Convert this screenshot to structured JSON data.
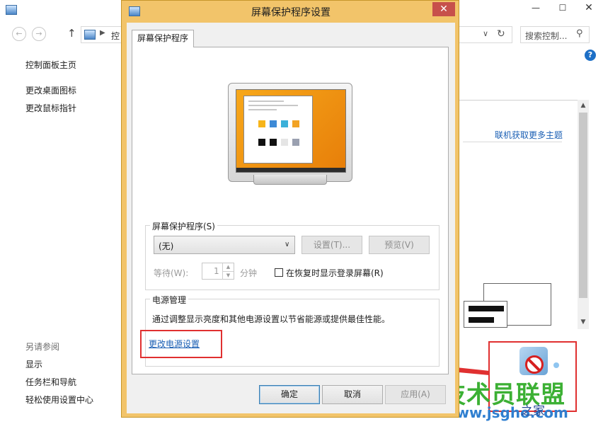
{
  "control_panel": {
    "address_text": "控",
    "search_placeholder": "搜索控制...",
    "sidebar_home": "控制面板主页",
    "sidebar_links": [
      "更改桌面图标",
      "更改鼠标指针"
    ],
    "see_also_heading": "另请参阅",
    "see_also_links": [
      "显示",
      "任务栏和导航",
      "轻松使用设置中心"
    ],
    "themes_link": "联机获取更多主题"
  },
  "dialog": {
    "title": "屏幕保护程序设置",
    "tab_label": "屏幕保护程序",
    "saver_group_label": "屏幕保护程序(S)",
    "saver_selected": "(无)",
    "settings_button": "设置(T)...",
    "preview_button": "预览(V)",
    "wait_label": "等待(W):",
    "wait_value": "1",
    "wait_unit": "分钟",
    "resume_checkbox_label": "在恢复时显示登录屏幕(R)",
    "resume_checked": false,
    "power_group_label": "电源管理",
    "power_description": "通过调整显示亮度和其他电源设置以节省能源或提供最佳性能。",
    "power_link": "更改电源设置",
    "ok_button": "确定",
    "cancel_button": "取消",
    "apply_button": "应用(A)"
  },
  "watermark": {
    "brand": "技术员联盟",
    "url": "www.jsgho.com",
    "tail": "之家"
  },
  "colors": {
    "dialog_frame": "#f2c46a",
    "annotation_red": "#e03030",
    "link_blue": "#1a5fb4",
    "watermark_green": "#3cb034"
  }
}
